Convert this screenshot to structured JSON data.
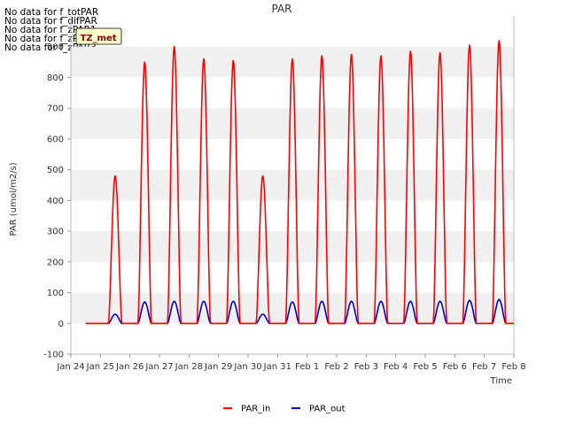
{
  "no_data_messages": [
    "No data for f_totPAR",
    "No data for f_difPAR",
    "No data for f_zPAR1",
    "No data for f_zPAR2",
    "No data for f_zPAR3"
  ],
  "tooltip_label": "TZ_met",
  "colors": {
    "par_in": "#ff0000",
    "par_out": "#0000cc",
    "band": "#f0f0f0",
    "axis": "#bbbbbb",
    "tooltip_bg": "#ffffcc"
  },
  "chart_data": {
    "type": "line",
    "title": "PAR",
    "xlabel": "Time",
    "ylabel": "PAR (umol/m2/s)",
    "xlim": [
      "2024-01-24",
      "2024-02-08"
    ],
    "ylim": [
      -100,
      1000
    ],
    "x_ticks": [
      "Jan 24",
      "Jan 25",
      "Jan 26",
      "Jan 27",
      "Jan 28",
      "Jan 29",
      "Jan 30",
      "Jan 31",
      "Feb 1",
      "Feb 2",
      "Feb 3",
      "Feb 4",
      "Feb 5",
      "Feb 6",
      "Feb 7",
      "Feb 8"
    ],
    "y_ticks": [
      -100,
      0,
      100,
      200,
      300,
      400,
      500,
      600,
      700,
      800,
      900
    ],
    "grid": "horizontal bands",
    "legend_position": "bottom",
    "daylight_hours": [
      "06:30",
      "17:30"
    ],
    "series": [
      {
        "name": "PAR_in",
        "color": "#ff0000",
        "daily_peaks": [
          {
            "date": "2024-01-25",
            "peak": 480
          },
          {
            "date": "2024-01-26",
            "peak": 850
          },
          {
            "date": "2024-01-27",
            "peak": 900
          },
          {
            "date": "2024-01-28",
            "peak": 860
          },
          {
            "date": "2024-01-29",
            "peak": 855
          },
          {
            "date": "2024-01-30",
            "peak": 480
          },
          {
            "date": "2024-01-31",
            "peak": 860
          },
          {
            "date": "2024-02-01",
            "peak": 870
          },
          {
            "date": "2024-02-02",
            "peak": 875
          },
          {
            "date": "2024-02-03",
            "peak": 870
          },
          {
            "date": "2024-02-04",
            "peak": 885
          },
          {
            "date": "2024-02-05",
            "peak": 880
          },
          {
            "date": "2024-02-06",
            "peak": 905
          },
          {
            "date": "2024-02-07",
            "peak": 920
          }
        ]
      },
      {
        "name": "PAR_out",
        "color": "#0000cc",
        "daily_peaks": [
          {
            "date": "2024-01-25",
            "peak": 30
          },
          {
            "date": "2024-01-26",
            "peak": 70
          },
          {
            "date": "2024-01-27",
            "peak": 72
          },
          {
            "date": "2024-01-28",
            "peak": 72
          },
          {
            "date": "2024-01-29",
            "peak": 72
          },
          {
            "date": "2024-01-30",
            "peak": 30
          },
          {
            "date": "2024-01-31",
            "peak": 70
          },
          {
            "date": "2024-02-01",
            "peak": 72
          },
          {
            "date": "2024-02-02",
            "peak": 72
          },
          {
            "date": "2024-02-03",
            "peak": 72
          },
          {
            "date": "2024-02-04",
            "peak": 72
          },
          {
            "date": "2024-02-05",
            "peak": 72
          },
          {
            "date": "2024-02-06",
            "peak": 75
          },
          {
            "date": "2024-02-07",
            "peak": 78
          }
        ]
      }
    ]
  }
}
